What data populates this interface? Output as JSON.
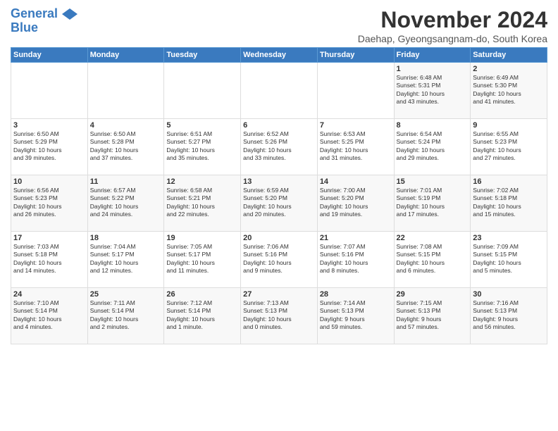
{
  "header": {
    "logo_line1": "General",
    "logo_line2": "Blue",
    "month_title": "November 2024",
    "location": "Daehap, Gyeongsangnam-do, South Korea"
  },
  "weekdays": [
    "Sunday",
    "Monday",
    "Tuesday",
    "Wednesday",
    "Thursday",
    "Friday",
    "Saturday"
  ],
  "weeks": [
    [
      {
        "day": "",
        "info": ""
      },
      {
        "day": "",
        "info": ""
      },
      {
        "day": "",
        "info": ""
      },
      {
        "day": "",
        "info": ""
      },
      {
        "day": "",
        "info": ""
      },
      {
        "day": "1",
        "info": "Sunrise: 6:48 AM\nSunset: 5:31 PM\nDaylight: 10 hours\nand 43 minutes."
      },
      {
        "day": "2",
        "info": "Sunrise: 6:49 AM\nSunset: 5:30 PM\nDaylight: 10 hours\nand 41 minutes."
      }
    ],
    [
      {
        "day": "3",
        "info": "Sunrise: 6:50 AM\nSunset: 5:29 PM\nDaylight: 10 hours\nand 39 minutes."
      },
      {
        "day": "4",
        "info": "Sunrise: 6:50 AM\nSunset: 5:28 PM\nDaylight: 10 hours\nand 37 minutes."
      },
      {
        "day": "5",
        "info": "Sunrise: 6:51 AM\nSunset: 5:27 PM\nDaylight: 10 hours\nand 35 minutes."
      },
      {
        "day": "6",
        "info": "Sunrise: 6:52 AM\nSunset: 5:26 PM\nDaylight: 10 hours\nand 33 minutes."
      },
      {
        "day": "7",
        "info": "Sunrise: 6:53 AM\nSunset: 5:25 PM\nDaylight: 10 hours\nand 31 minutes."
      },
      {
        "day": "8",
        "info": "Sunrise: 6:54 AM\nSunset: 5:24 PM\nDaylight: 10 hours\nand 29 minutes."
      },
      {
        "day": "9",
        "info": "Sunrise: 6:55 AM\nSunset: 5:23 PM\nDaylight: 10 hours\nand 27 minutes."
      }
    ],
    [
      {
        "day": "10",
        "info": "Sunrise: 6:56 AM\nSunset: 5:23 PM\nDaylight: 10 hours\nand 26 minutes."
      },
      {
        "day": "11",
        "info": "Sunrise: 6:57 AM\nSunset: 5:22 PM\nDaylight: 10 hours\nand 24 minutes."
      },
      {
        "day": "12",
        "info": "Sunrise: 6:58 AM\nSunset: 5:21 PM\nDaylight: 10 hours\nand 22 minutes."
      },
      {
        "day": "13",
        "info": "Sunrise: 6:59 AM\nSunset: 5:20 PM\nDaylight: 10 hours\nand 20 minutes."
      },
      {
        "day": "14",
        "info": "Sunrise: 7:00 AM\nSunset: 5:20 PM\nDaylight: 10 hours\nand 19 minutes."
      },
      {
        "day": "15",
        "info": "Sunrise: 7:01 AM\nSunset: 5:19 PM\nDaylight: 10 hours\nand 17 minutes."
      },
      {
        "day": "16",
        "info": "Sunrise: 7:02 AM\nSunset: 5:18 PM\nDaylight: 10 hours\nand 15 minutes."
      }
    ],
    [
      {
        "day": "17",
        "info": "Sunrise: 7:03 AM\nSunset: 5:18 PM\nDaylight: 10 hours\nand 14 minutes."
      },
      {
        "day": "18",
        "info": "Sunrise: 7:04 AM\nSunset: 5:17 PM\nDaylight: 10 hours\nand 12 minutes."
      },
      {
        "day": "19",
        "info": "Sunrise: 7:05 AM\nSunset: 5:17 PM\nDaylight: 10 hours\nand 11 minutes."
      },
      {
        "day": "20",
        "info": "Sunrise: 7:06 AM\nSunset: 5:16 PM\nDaylight: 10 hours\nand 9 minutes."
      },
      {
        "day": "21",
        "info": "Sunrise: 7:07 AM\nSunset: 5:16 PM\nDaylight: 10 hours\nand 8 minutes."
      },
      {
        "day": "22",
        "info": "Sunrise: 7:08 AM\nSunset: 5:15 PM\nDaylight: 10 hours\nand 6 minutes."
      },
      {
        "day": "23",
        "info": "Sunrise: 7:09 AM\nSunset: 5:15 PM\nDaylight: 10 hours\nand 5 minutes."
      }
    ],
    [
      {
        "day": "24",
        "info": "Sunrise: 7:10 AM\nSunset: 5:14 PM\nDaylight: 10 hours\nand 4 minutes."
      },
      {
        "day": "25",
        "info": "Sunrise: 7:11 AM\nSunset: 5:14 PM\nDaylight: 10 hours\nand 2 minutes."
      },
      {
        "day": "26",
        "info": "Sunrise: 7:12 AM\nSunset: 5:14 PM\nDaylight: 10 hours\nand 1 minute."
      },
      {
        "day": "27",
        "info": "Sunrise: 7:13 AM\nSunset: 5:13 PM\nDaylight: 10 hours\nand 0 minutes."
      },
      {
        "day": "28",
        "info": "Sunrise: 7:14 AM\nSunset: 5:13 PM\nDaylight: 9 hours\nand 59 minutes."
      },
      {
        "day": "29",
        "info": "Sunrise: 7:15 AM\nSunset: 5:13 PM\nDaylight: 9 hours\nand 57 minutes."
      },
      {
        "day": "30",
        "info": "Sunrise: 7:16 AM\nSunset: 5:13 PM\nDaylight: 9 hours\nand 56 minutes."
      }
    ]
  ]
}
